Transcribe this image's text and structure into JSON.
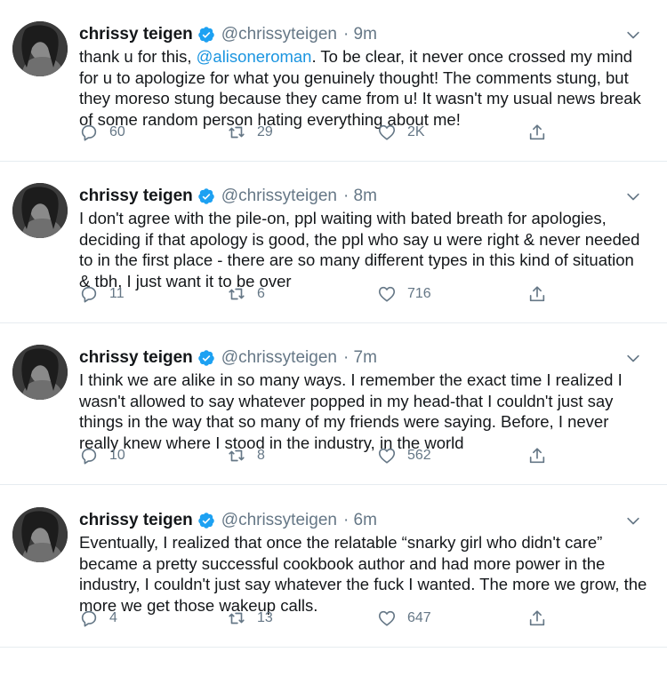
{
  "author": {
    "name": "chrissy teigen",
    "handle": "@chrissyteigen"
  },
  "icons": {
    "verified": "verified-badge-icon",
    "more": "chevron-down-icon",
    "reply": "reply-icon",
    "retweet": "retweet-icon",
    "like": "heart-icon",
    "share": "share-icon"
  },
  "colors": {
    "verified": "#1da1f2",
    "mention": "#1b95e0",
    "muted": "#657786"
  },
  "tweets": [
    {
      "time": "· 9m",
      "text_before": "thank u for this, ",
      "mention": "@alisoneroman",
      "text_after": ". To be clear, it never once crossed my mind for u to apologize for what you genuinely thought! The comments stung, but they moreso stung because they came from u! It wasn't my usual news break of some random person hating everything about me!",
      "replies": "60",
      "retweets": "29",
      "likes": "2K"
    },
    {
      "time": "· 8m",
      "text": "I don't agree with the pile-on, ppl waiting with bated breath for apologies, deciding if that apology is good, the ppl who say u were right & never needed to in the first place - there are so many different types in this kind of situation & tbh, I just want it to be over",
      "replies": "11",
      "retweets": "6",
      "likes": "716"
    },
    {
      "time": "· 7m",
      "text": "I think we are alike in so many ways. I remember the exact time I realized I wasn't allowed to say whatever popped in my head-that I couldn't just say things in the way that so many of my friends were saying. Before, I never really knew where I stood in the industry, in the world",
      "replies": "10",
      "retweets": "8",
      "likes": "562"
    },
    {
      "time": "· 6m",
      "text": "Eventually, I realized that once the relatable “snarky girl who didn't care” became a pretty successful cookbook author and had more power in the industry, I couldn't just say whatever the fuck I wanted.  The more we grow, the more we get those wakeup calls.",
      "replies": "4",
      "retweets": "13",
      "likes": "647"
    }
  ]
}
